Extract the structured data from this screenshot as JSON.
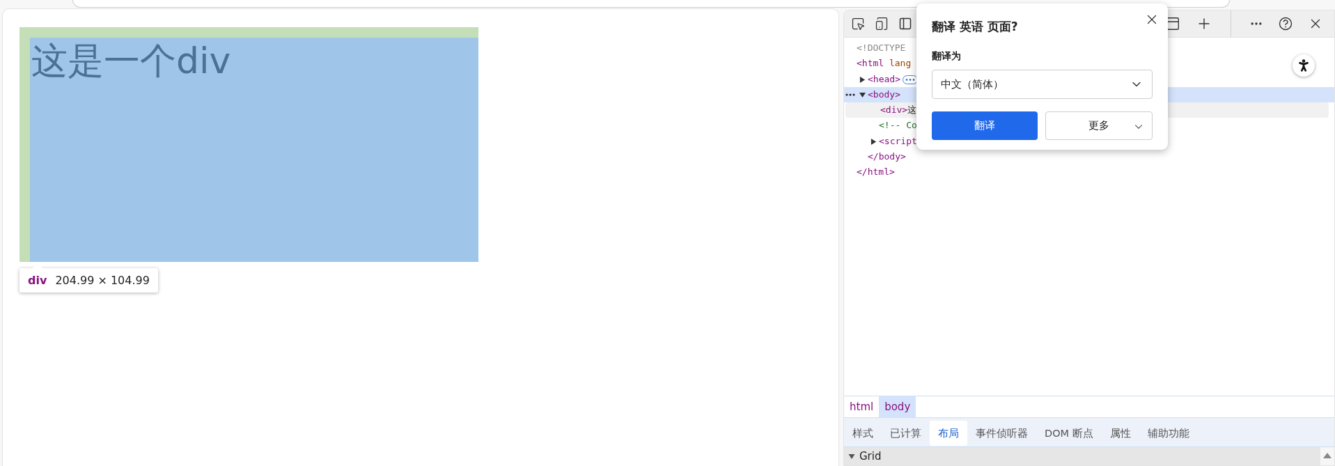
{
  "page": {
    "text": "这是一个div",
    "tooltip": {
      "tag": "div",
      "size": "204.99 × 104.99"
    }
  },
  "dom_tree": [
    {
      "kind": "doctype",
      "text": "<!DOCTYPE",
      "selected": false,
      "hovered": false
    },
    {
      "kind": "element",
      "tag": "<html",
      "attr": " lang",
      "close": "</html>",
      "selected": false,
      "hovered": false,
      "children": [
        {
          "kind": "element",
          "tag": "<head>",
          "expanded": false,
          "selected": false,
          "hovered": false
        },
        {
          "kind": "element",
          "tag": "<body>",
          "close": "</body>",
          "expanded": true,
          "selected": true,
          "hovered": false,
          "children": [
            {
              "kind": "element",
              "tag": "<div>",
              "content": "这",
              "selected": false,
              "hovered": true
            },
            {
              "kind": "comment",
              "text": "<!-- Co",
              "selected": false,
              "hovered": false
            },
            {
              "kind": "element",
              "tag": "<script",
              "expanded": false,
              "selected": false,
              "hovered": false
            }
          ]
        }
      ]
    }
  ],
  "breadcrumbs": [
    {
      "label": "html",
      "selected": false
    },
    {
      "label": "body",
      "selected": true
    }
  ],
  "panel_tabs": [
    {
      "label": "样式",
      "selected": false
    },
    {
      "label": "已计算",
      "selected": false
    },
    {
      "label": "布局",
      "selected": true
    },
    {
      "label": "事件侦听器",
      "selected": false
    },
    {
      "label": "DOM 断点",
      "selected": false
    },
    {
      "label": "属性",
      "selected": false
    },
    {
      "label": "辅助功能",
      "selected": false
    }
  ],
  "sections": [
    {
      "label": "Grid",
      "expanded": true
    }
  ],
  "translate_popup": {
    "title": "翻译 英语 页面?",
    "target_label": "翻译为",
    "target_language": "中文（简体）",
    "buttons": [
      {
        "label": "翻译",
        "kind": "primary"
      },
      {
        "label": "更多",
        "kind": "menu"
      }
    ]
  }
}
